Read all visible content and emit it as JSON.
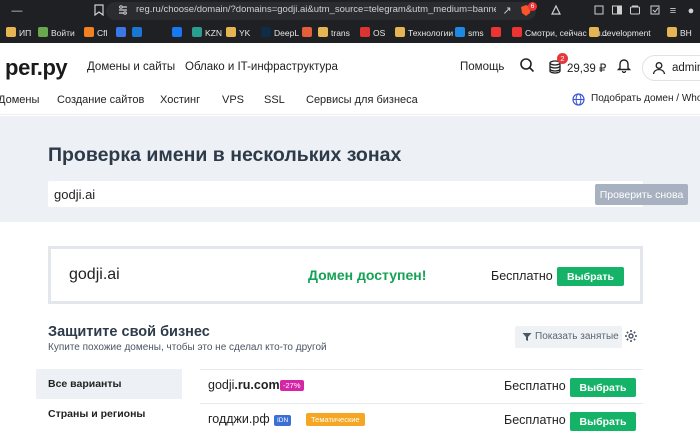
{
  "browser": {
    "url": "reg.ru/choose/domain/?domains=godji.ai&utm_source=telegram&utm_medium=banner&ut...",
    "extension_badge": "6",
    "bookmarks": [
      {
        "label": "ИП",
        "color": "#e6b450"
      },
      {
        "label": "Войти",
        "color": "#6aa84f"
      },
      {
        "label": "Cfl",
        "color": "#f48120"
      },
      {
        "label": "",
        "color": "#3b78e7"
      },
      {
        "label": "",
        "color": "#1976d2"
      },
      {
        "label": "",
        "color": "#1877f2"
      },
      {
        "label": "KZN",
        "color": "#2a9d8f"
      },
      {
        "label": "YK",
        "color": "#e6b450"
      },
      {
        "label": "DeepL",
        "color": "#0f2b46"
      },
      {
        "label": "",
        "color": "#e55e3c"
      },
      {
        "label": "trans",
        "color": "#e6b450"
      },
      {
        "label": "OS",
        "color": "#d33"
      },
      {
        "label": "Технологии",
        "color": "#e6b450"
      },
      {
        "label": "sms",
        "color": "#1e88e5"
      },
      {
        "label": "",
        "color": "#e33"
      },
      {
        "label": "Смотри, сейчас я п...",
        "color": "#e33"
      },
      {
        "label": "development",
        "color": "#e6b450"
      },
      {
        "label": "ВН",
        "color": "#e6b450"
      }
    ]
  },
  "header": {
    "logo": "рег.ру",
    "nav": [
      "Домены и сайты",
      "Облако и IT-инфраструктура"
    ],
    "help": "Помощь",
    "cart_count": "2",
    "balance": "29,39 ₽",
    "user": "admin"
  },
  "subnav": {
    "items": [
      "Домены",
      "Создание сайтов",
      "Хостинг",
      "VPS",
      "SSL",
      "Сервисы для бизнеса"
    ],
    "whois": "Подобрать домен / Whois"
  },
  "hero": {
    "title": "Проверка имени в нескольких зонах",
    "search_value": "godji.ai",
    "search_button": "Проверить снова"
  },
  "result": {
    "name": "godji",
    "tld": ".ai",
    "status": "Домен доступен!",
    "price": "Бесплатно",
    "button": "Выбрать"
  },
  "protect": {
    "title": "Защитите свой бизнес",
    "subtitle": "Купите похожие домены, чтобы это не сделал кто-то другой",
    "show_taken": "Показать занятые"
  },
  "sidebar": {
    "items": [
      "Все варианты",
      "Страны и регионы"
    ]
  },
  "suggestions": [
    {
      "name": "godji",
      "tld": ".ru.com",
      "tag": "-27%",
      "tag_color": "#d626a8",
      "tag2": "",
      "price": "Бесплатно",
      "button": "Выбрать"
    },
    {
      "name": "годджи.рф",
      "tld": "",
      "tag": "IDN",
      "tag_color": "#3b6fd8",
      "tag2": "Тематические",
      "price": "Бесплатно",
      "button": "Выбрать"
    }
  ]
}
